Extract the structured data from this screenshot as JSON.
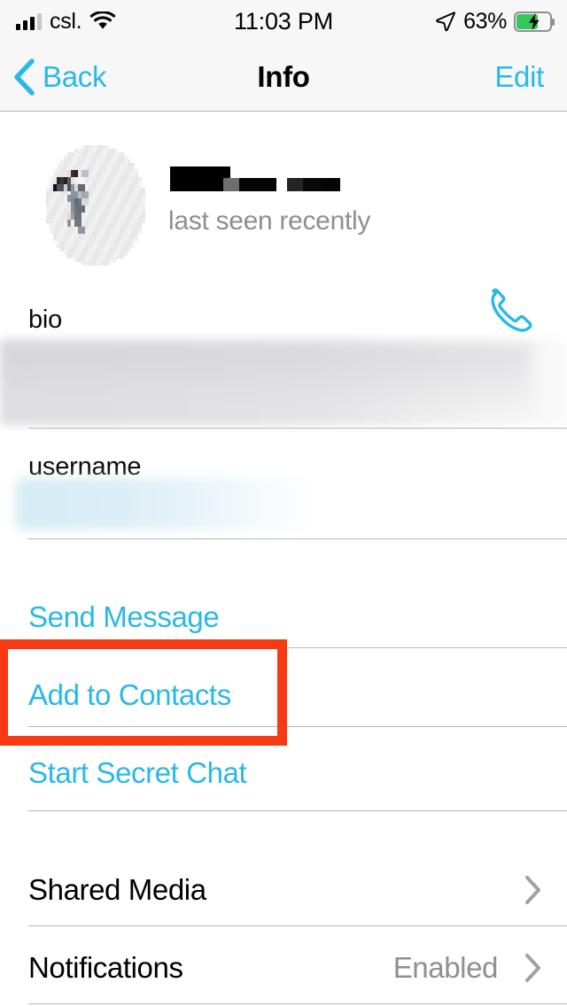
{
  "status_bar": {
    "carrier": "csl.",
    "signal_bars_total": 4,
    "signal_bars_filled": 3,
    "wifi_icon": "wifi-icon",
    "time": "11:03 PM",
    "location_icon": "location-arrow-icon",
    "battery_percent_label": "63%",
    "battery_level": 63,
    "battery_charging": true,
    "battery_color": "#35c759"
  },
  "nav_bar": {
    "back_label": "Back",
    "back_icon": "chevron-left-icon",
    "title": "Info",
    "edit_label": "Edit"
  },
  "profile": {
    "avatar": "redacted-pixelated-avatar",
    "name": "",
    "name_redacted": true,
    "status": "last seen recently",
    "call_icon": "phone-icon"
  },
  "fields": [
    {
      "label": "bio",
      "value": "",
      "value_redacted": true,
      "redaction_style": "blur-grey"
    },
    {
      "label": "username",
      "value": "",
      "value_redacted": true,
      "redaction_style": "blur-blue"
    }
  ],
  "actions": [
    {
      "label": "Send Message",
      "name": "send-message"
    },
    {
      "label": "Add to Contacts",
      "name": "add-to-contacts",
      "highlighted": true
    },
    {
      "label": "Start Secret Chat",
      "name": "start-secret-chat"
    }
  ],
  "settings_rows": [
    {
      "label": "Shared Media",
      "value": "",
      "chevron": "chevron-right-icon"
    },
    {
      "label": "Notifications",
      "value": "Enabled",
      "chevron": "chevron-right-icon"
    }
  ],
  "annotation": {
    "target": "Add to Contacts",
    "color": "#f63a12",
    "shape": "rectangle-outline"
  },
  "colors": {
    "accent": "#2ab8e8",
    "text_primary": "#000000",
    "text_secondary": "#8e8e93",
    "separator": "#b8b8b8",
    "bar_background": "#f7f7f7",
    "annotation": "#f63a12"
  }
}
